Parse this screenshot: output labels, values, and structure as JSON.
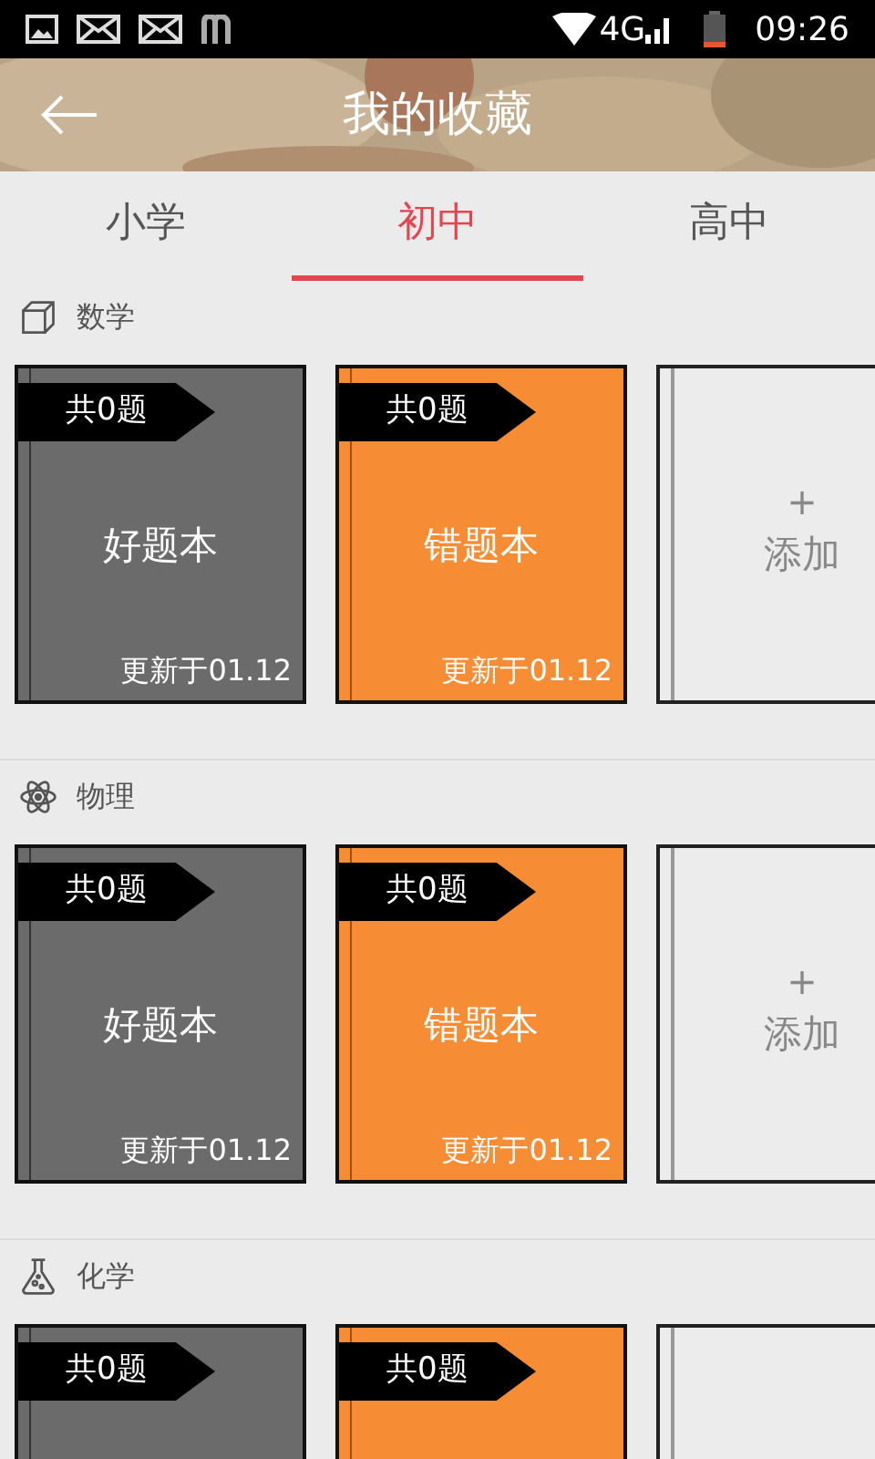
{
  "status_bar": {
    "network": "4G",
    "time": "09:26"
  },
  "header": {
    "title": "我的收藏"
  },
  "tabs": [
    {
      "label": "小学",
      "selected": false
    },
    {
      "label": "初中",
      "selected": true
    },
    {
      "label": "高中",
      "selected": false
    }
  ],
  "sections": [
    {
      "name": "数学",
      "kind": "cube",
      "cards": [
        {
          "kind": "good",
          "count": "共0题",
          "title": "好题本",
          "updated": "更新于01.12"
        },
        {
          "kind": "wrong",
          "count": "共0题",
          "title": "错题本",
          "updated": "更新于01.12"
        },
        {
          "kind": "add",
          "plus": "+",
          "label": "添加"
        }
      ]
    },
    {
      "name": "物理",
      "kind": "atom",
      "cards": [
        {
          "kind": "good",
          "count": "共0题",
          "title": "好题本",
          "updated": "更新于01.12"
        },
        {
          "kind": "wrong",
          "count": "共0题",
          "title": "错题本",
          "updated": "更新于01.12"
        },
        {
          "kind": "add",
          "plus": "+",
          "label": "添加"
        }
      ]
    },
    {
      "name": "化学",
      "kind": "flask",
      "cards": [
        {
          "kind": "good",
          "count": "共0题"
        },
        {
          "kind": "wrong",
          "count": "共0题"
        },
        {
          "kind": "add"
        }
      ]
    }
  ]
}
